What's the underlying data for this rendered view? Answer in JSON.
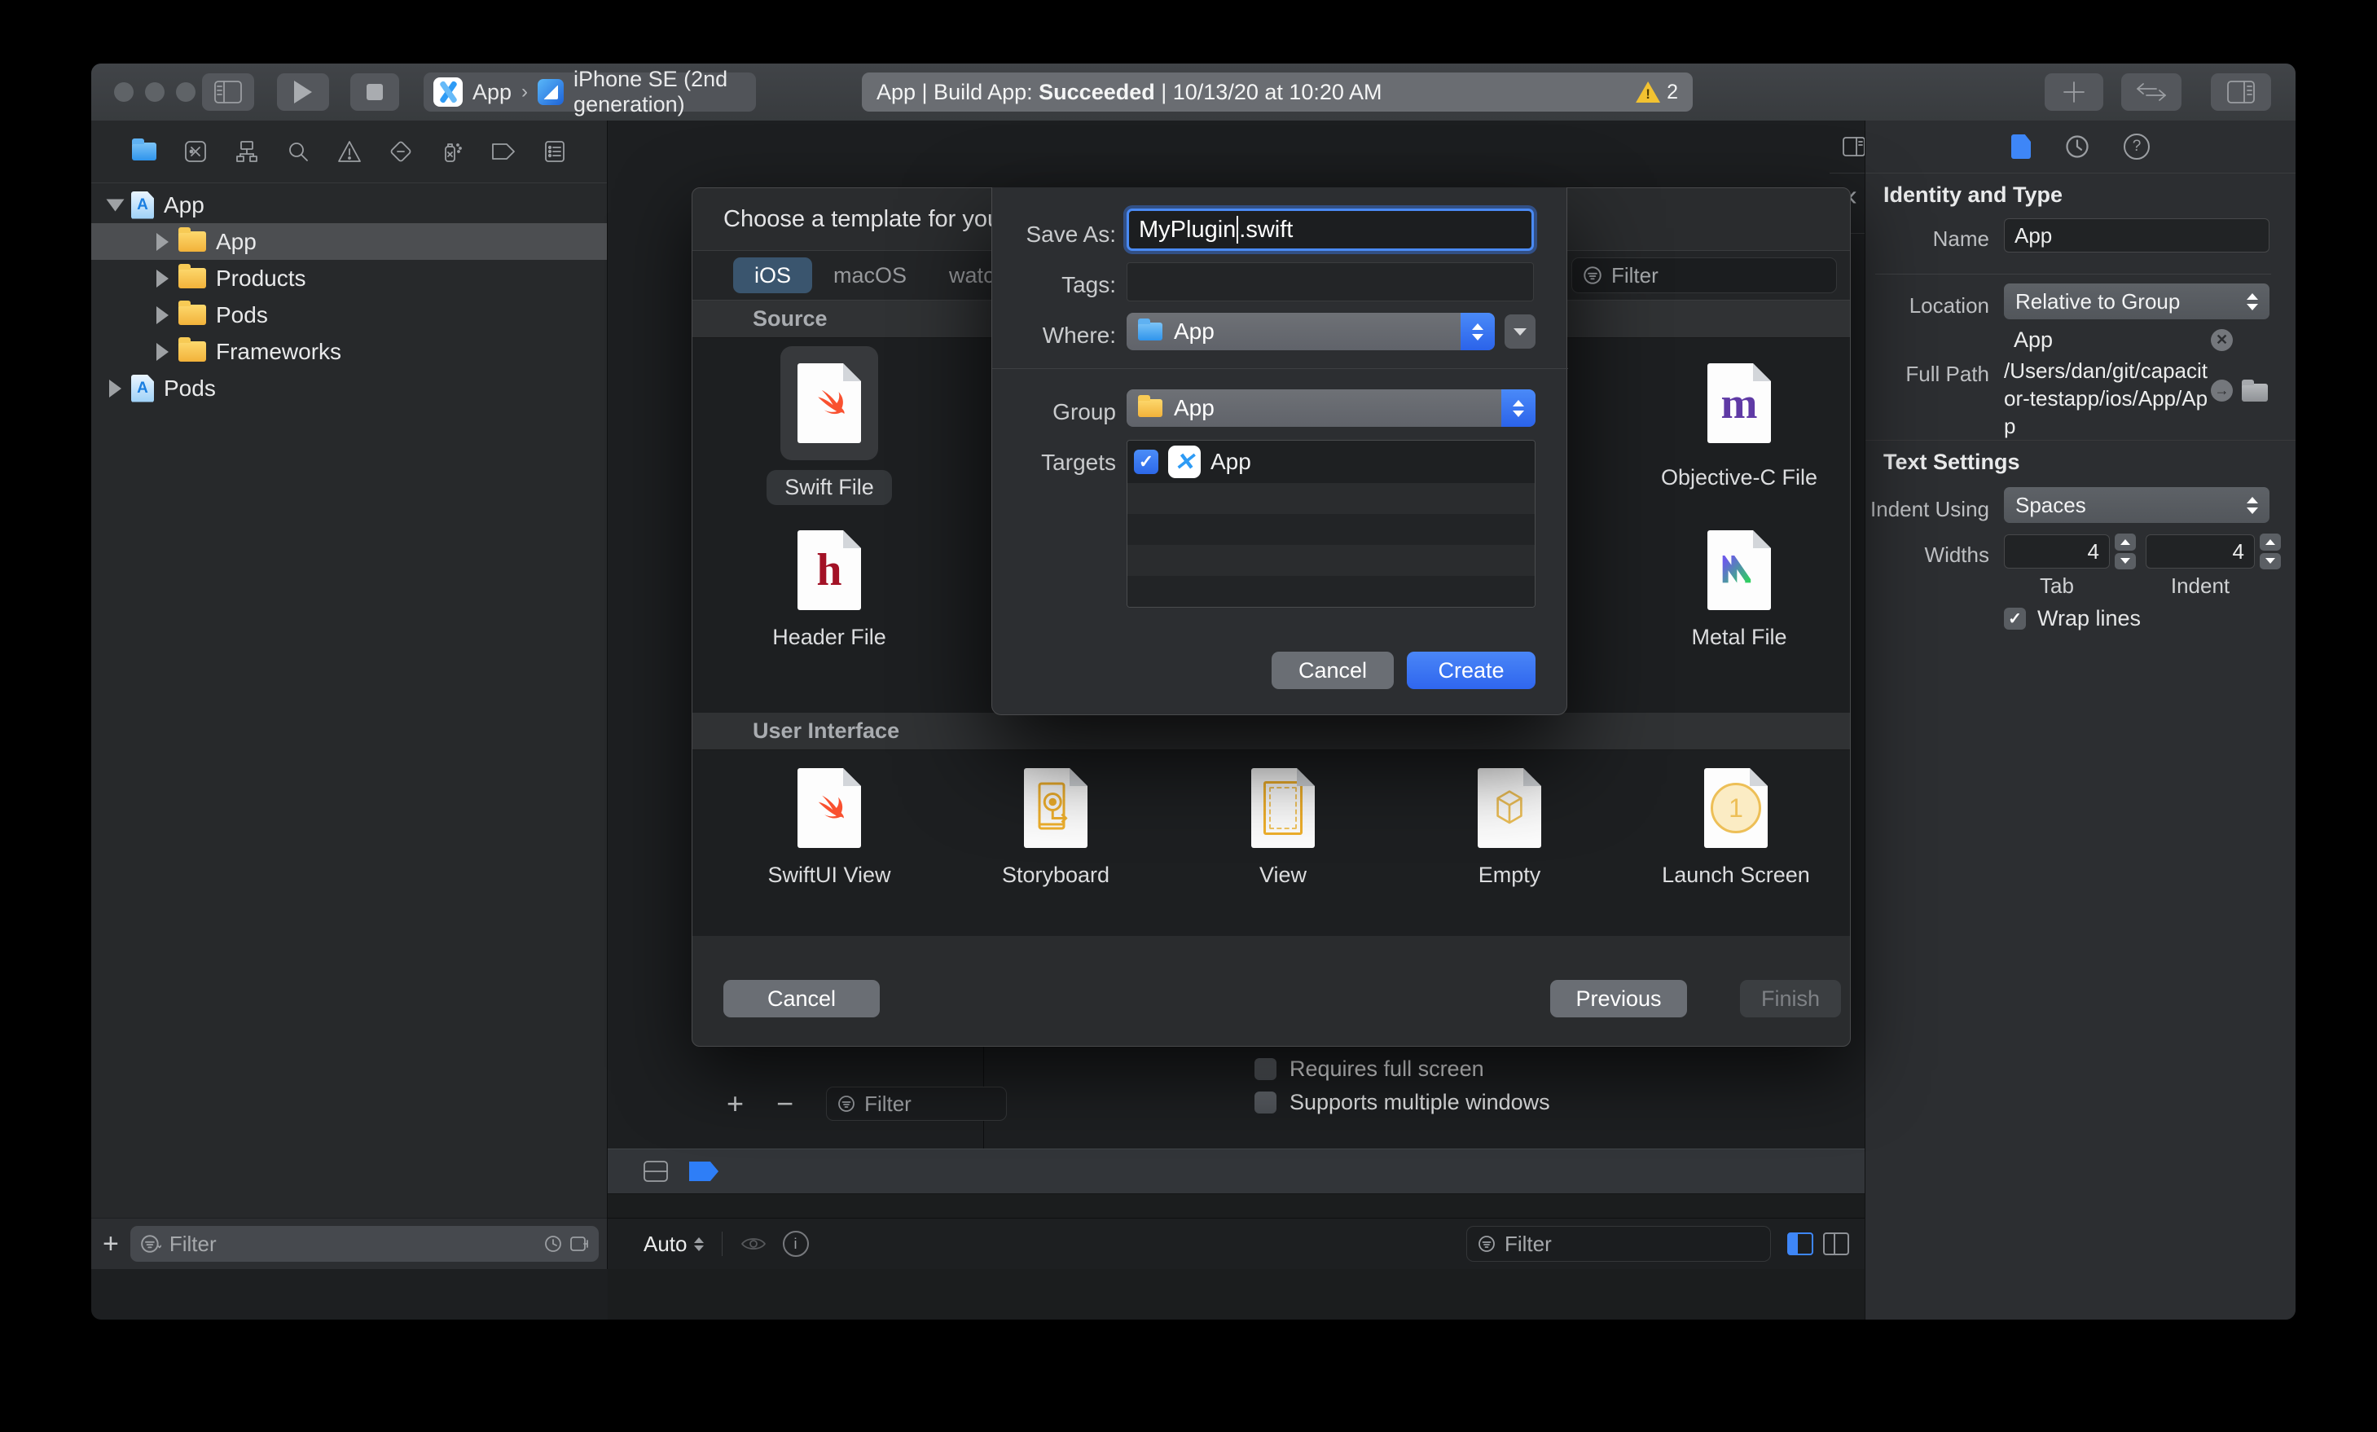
{
  "toolbar": {
    "scheme_app": "App",
    "scheme_separator": "›",
    "scheme_device": "iPhone SE (2nd generation)",
    "status_prefix": "App | Build App: ",
    "status_bold": "Succeeded",
    "status_suffix": " | 10/13/20 at 10:20 AM",
    "warning_count": "2"
  },
  "navigator": {
    "rows": [
      {
        "label": "App"
      },
      {
        "label": "App"
      },
      {
        "label": "Products"
      },
      {
        "label": "Pods"
      },
      {
        "label": "Frameworks"
      },
      {
        "label": "Pods"
      }
    ],
    "filter_placeholder": "Filter"
  },
  "dialog": {
    "title": "Choose a template for your",
    "tabs": [
      {
        "label": "iOS"
      },
      {
        "label": "macOS"
      },
      {
        "label": "watchOS"
      }
    ],
    "filter_placeholder": "Filter",
    "source_title": "Source",
    "items": {
      "swift": "Swift File",
      "header": "Header File",
      "objc": "Objective-C File",
      "metal": "Metal File"
    },
    "ui_title": "User Interface",
    "ui_items": {
      "swiftui": "SwiftUI View",
      "storyboard": "Storyboard",
      "view": "View",
      "empty": "Empty",
      "launch": "Launch Screen"
    },
    "cancel": "Cancel",
    "previous": "Previous",
    "finish": "Finish",
    "glyphs": {
      "header_h": "h",
      "objc_m": "m",
      "launch_1": "1"
    },
    "nav_back": "‹",
    "nav_forward": "›"
  },
  "sheet": {
    "save_as_label": "Save As:",
    "filename_name": "MyPlugin",
    "filename_ext": ".swift",
    "tags_label": "Tags:",
    "where_label": "Where:",
    "where_value": "App",
    "group_label": "Group",
    "group_value": "App",
    "targets_label": "Targets",
    "target_name": "App",
    "target_check": "✓",
    "cancel": "Cancel",
    "create": "Create"
  },
  "editor": {
    "checkbox_fullscreen": "Requires full screen",
    "checkbox_multiwindow": "Supports multiple windows",
    "add_label": "+",
    "remove_label": "−",
    "filter_placeholder": "Filter"
  },
  "inspector": {
    "identity_title": "Identity and Type",
    "name_label": "Name",
    "name_value": "App",
    "location_label": "Location",
    "location_value": "Relative to Group",
    "group_value": "App",
    "fullpath_label": "Full Path",
    "fullpath_value": "/Users/dan/git/capacitor-testapp/ios/App/App",
    "textsettings_title": "Text Settings",
    "indent_label": "Indent Using",
    "indent_value": "Spaces",
    "widths_label": "Widths",
    "tab_value": "4",
    "tab_label": "Tab",
    "indent_width_value": "4",
    "indent_width_label": "Indent",
    "wrap_label": "Wrap lines",
    "wrap_check": "✓"
  },
  "statusbar": {
    "auto_label": "Auto",
    "filter_left_placeholder": "Filter",
    "filter_right_placeholder": "Filter"
  },
  "colors": {
    "accent_blue": "#3c7ef7",
    "warning_yellow": "#f2c231",
    "create_blue": "#3b77f2",
    "selected_tab": "#3a556e"
  }
}
